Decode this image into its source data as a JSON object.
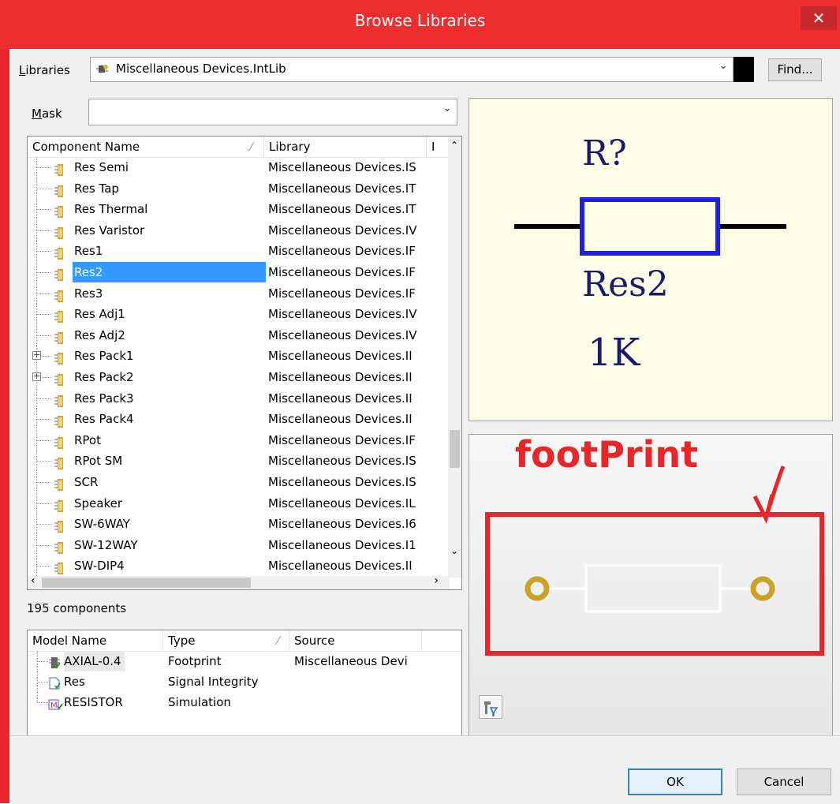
{
  "window": {
    "title": "Browse Libraries",
    "close_glyph": "✕"
  },
  "libraries": {
    "label_prefix": "",
    "label_accel": "L",
    "label_rest": "ibraries",
    "value": "Miscellaneous Devices.IntLib",
    "dropdown_glyph": "⌄",
    "find_label": "Find..."
  },
  "mask": {
    "label_accel": "M",
    "label_rest": "ask",
    "value": "",
    "dropdown_glyph": "⌄"
  },
  "components": {
    "headers": [
      "Component Name",
      "Library",
      "I"
    ],
    "sort_glyph": "⁄",
    "rows": [
      {
        "name": "Res Semi",
        "lib": "Miscellaneous Devices.I",
        "extra": "S",
        "expand": false
      },
      {
        "name": "Res Tap",
        "lib": "Miscellaneous Devices.I",
        "extra": "T",
        "expand": false
      },
      {
        "name": "Res Thermal",
        "lib": "Miscellaneous Devices.I",
        "extra": "T",
        "expand": false
      },
      {
        "name": "Res Varistor",
        "lib": "Miscellaneous Devices.I",
        "extra": "V",
        "expand": false
      },
      {
        "name": "Res1",
        "lib": "Miscellaneous Devices.I",
        "extra": "F",
        "expand": false
      },
      {
        "name": "Res2",
        "lib": "Miscellaneous Devices.I",
        "extra": "F",
        "expand": false,
        "selected": true
      },
      {
        "name": "Res3",
        "lib": "Miscellaneous Devices.I",
        "extra": "F",
        "expand": false
      },
      {
        "name": "Res Adj1",
        "lib": "Miscellaneous Devices.I",
        "extra": "V",
        "expand": false
      },
      {
        "name": "Res Adj2",
        "lib": "Miscellaneous Devices.I",
        "extra": "V",
        "expand": false
      },
      {
        "name": "Res Pack1",
        "lib": "Miscellaneous Devices.I",
        "extra": "I",
        "expand": true
      },
      {
        "name": "Res Pack2",
        "lib": "Miscellaneous Devices.I",
        "extra": "I",
        "expand": true
      },
      {
        "name": "Res Pack3",
        "lib": "Miscellaneous Devices.I",
        "extra": "I",
        "expand": false
      },
      {
        "name": "Res Pack4",
        "lib": "Miscellaneous Devices.I",
        "extra": "I",
        "expand": false
      },
      {
        "name": "RPot",
        "lib": "Miscellaneous Devices.I",
        "extra": "F",
        "expand": false
      },
      {
        "name": "RPot SM",
        "lib": "Miscellaneous Devices.I",
        "extra": "S",
        "expand": false
      },
      {
        "name": "SCR",
        "lib": "Miscellaneous Devices.I",
        "extra": "S",
        "expand": false
      },
      {
        "name": "Speaker",
        "lib": "Miscellaneous Devices.I",
        "extra": "L",
        "expand": false
      },
      {
        "name": "SW-6WAY",
        "lib": "Miscellaneous Devices.I",
        "extra": "6",
        "expand": false
      },
      {
        "name": "SW-12WAY",
        "lib": "Miscellaneous Devices.I",
        "extra": "1",
        "expand": false
      },
      {
        "name": "SW-DIP4",
        "lib": "Miscellaneous Devices.I",
        "extra": "I",
        "expand": false
      }
    ],
    "count_text": "195 components"
  },
  "models": {
    "headers": [
      "Model Name",
      "Type",
      "Source"
    ],
    "sort_glyph": "⁄",
    "rows": [
      {
        "name": "AXIAL-0.4",
        "type": "Footprint",
        "source": "Miscellaneous Devi",
        "icon": "footprint-icon"
      },
      {
        "name": "Res",
        "type": "Signal Integrity",
        "source": "",
        "icon": "signal-integrity-icon"
      },
      {
        "name": "RESISTOR",
        "type": "Simulation",
        "source": "",
        "icon": "simulation-icon"
      }
    ]
  },
  "schematic": {
    "designator": "R?",
    "comment": "Res2",
    "value": "1K",
    "bg_color": "#fdfde8",
    "text_color": "#1b1b6e",
    "body_color": "#1f1fe8"
  },
  "footprint": {
    "annotation": "footPrint",
    "annotation_color": "#e8262a",
    "pad_color": "#c9a227"
  },
  "buttons": {
    "ok": "OK",
    "cancel": "Cancel"
  },
  "colors": {
    "titlebar": "#ee2e2e",
    "selection": "#3399ff"
  }
}
